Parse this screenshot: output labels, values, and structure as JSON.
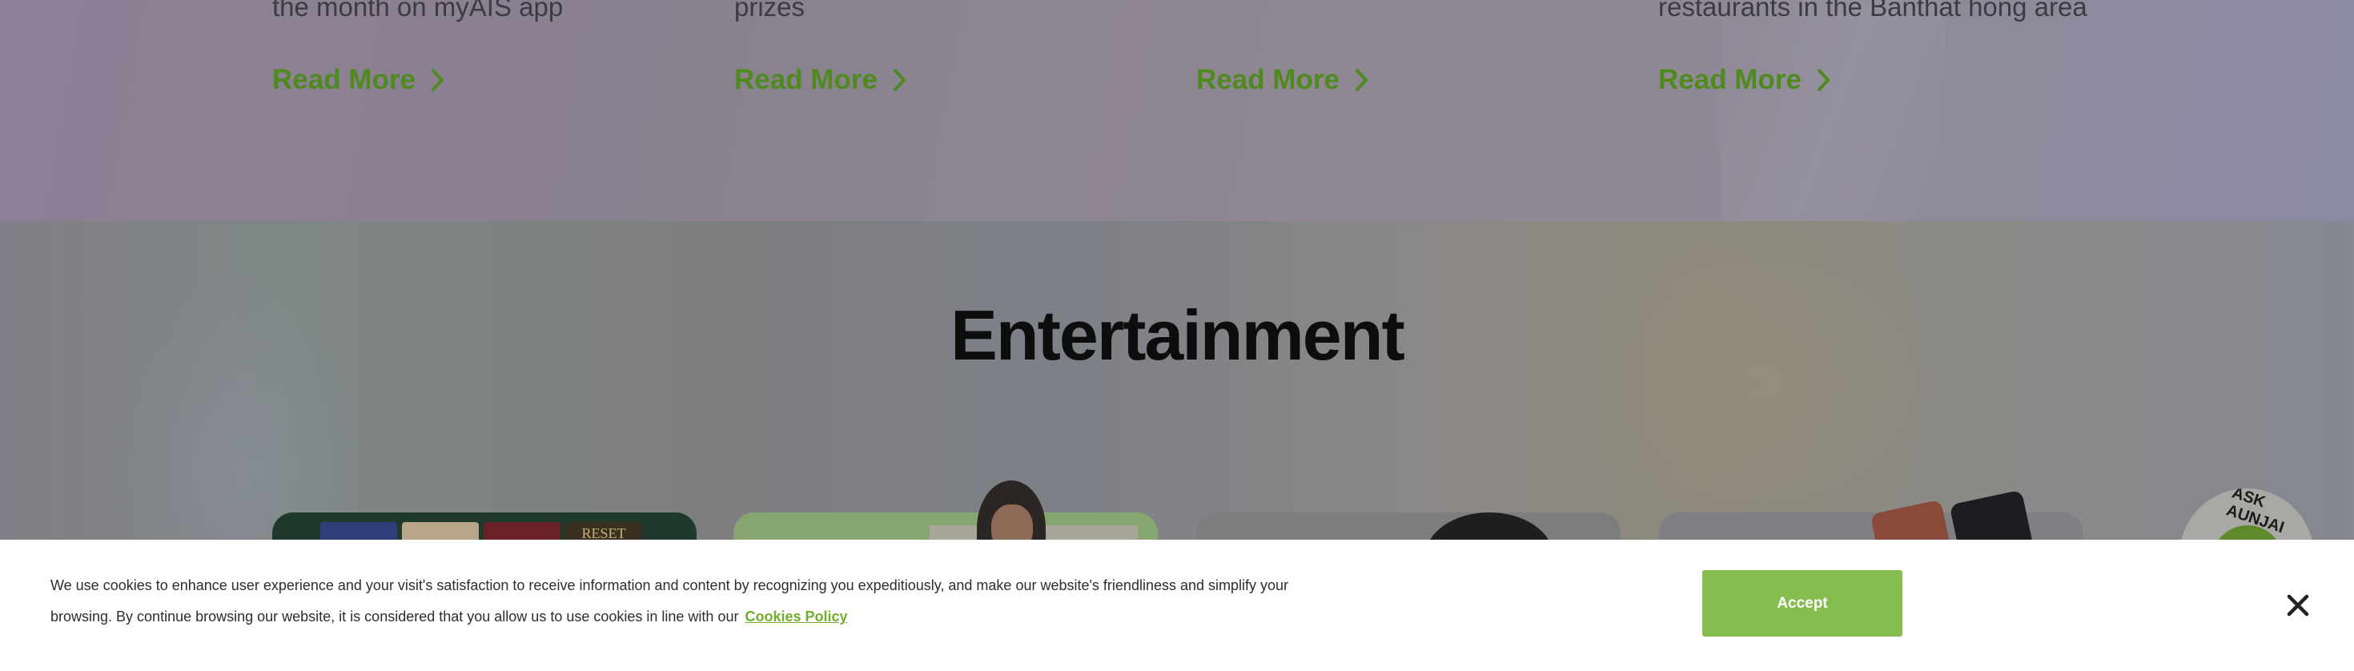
{
  "promo_row": {
    "items": [
      {
        "text": "the month on myAIS app",
        "link": "Read More"
      },
      {
        "text": "prizes",
        "link": "Read More"
      },
      {
        "text": "",
        "link": "Read More"
      },
      {
        "text": "restaurants in the Banthat hong area",
        "link": "Read More"
      }
    ]
  },
  "entertainment": {
    "title": "Entertainment",
    "card1_thumb_label": "RESET"
  },
  "chat_widget": {
    "label": "ASK AUNJAI"
  },
  "cookie_banner": {
    "text": "We use cookies to enhance user experience and your visit's satisfaction to receive information and content by recognizing you expeditiously, and make our website's friendliness and simplify your browsing. By continue browsing our website, it is considered that you allow us to use cookies in line with our",
    "policy_link": "Cookies Policy",
    "accept_label": "Accept"
  },
  "colors": {
    "accent": "#86bd4f",
    "link": "#4f8a1e"
  },
  "icons": {
    "read_more": "chevron-right-icon",
    "close": "close-icon"
  }
}
